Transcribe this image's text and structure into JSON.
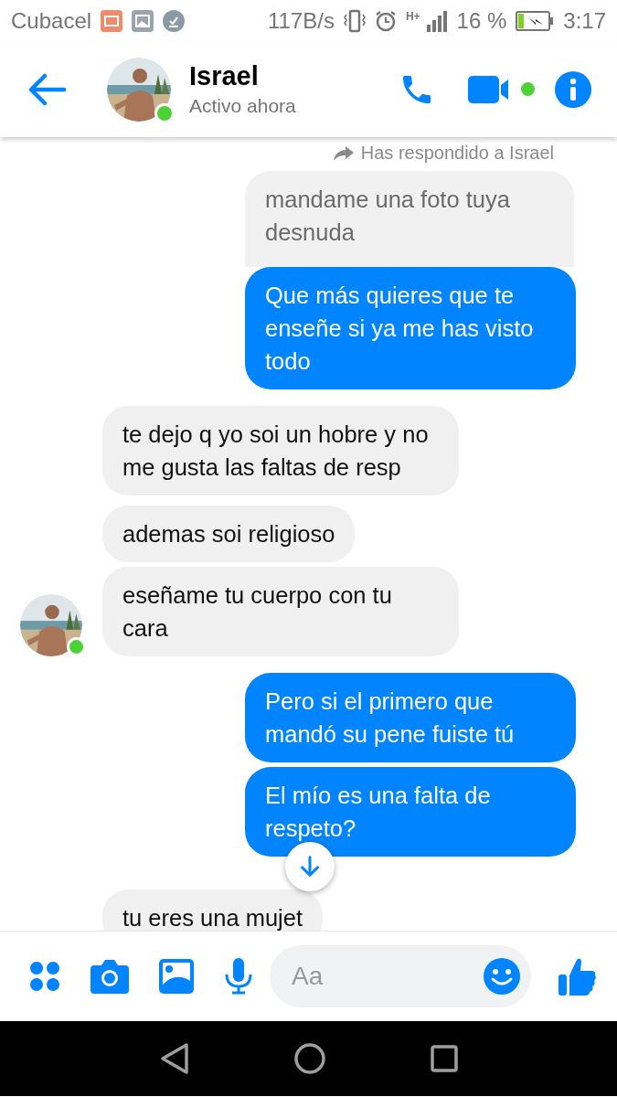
{
  "status_bar": {
    "carrier": "Cubacel",
    "speed": "117B/s",
    "network": "H+",
    "battery": "16 %",
    "charging": true,
    "time": "3:17"
  },
  "header": {
    "name": "Israel",
    "status": "Activo ahora",
    "online": true,
    "video_online": true
  },
  "messages": [
    {
      "kind": "reply_note",
      "text": "Has respondido a Israel"
    },
    {
      "kind": "quoted",
      "text": "mandame una foto tuya desnuda"
    },
    {
      "kind": "sent",
      "text": "Que más quieres que te enseñe si ya me has visto todo"
    },
    {
      "kind": "received",
      "text": "te dejo q yo soi un hobre y no me gusta las faltas de resp",
      "avatar": false
    },
    {
      "kind": "received",
      "text": "ademas soi religioso",
      "avatar": false
    },
    {
      "kind": "received",
      "text": "eseñame tu cuerpo con tu cara",
      "avatar": true
    },
    {
      "kind": "sent",
      "text": "Pero si el primero que mandó su pene fuiste tú"
    },
    {
      "kind": "sent",
      "text": "El mío es una falta de respeto?"
    },
    {
      "kind": "received",
      "text": "tu eres una mujet",
      "avatar": false
    }
  ],
  "composer": {
    "placeholder": "Aa"
  }
}
